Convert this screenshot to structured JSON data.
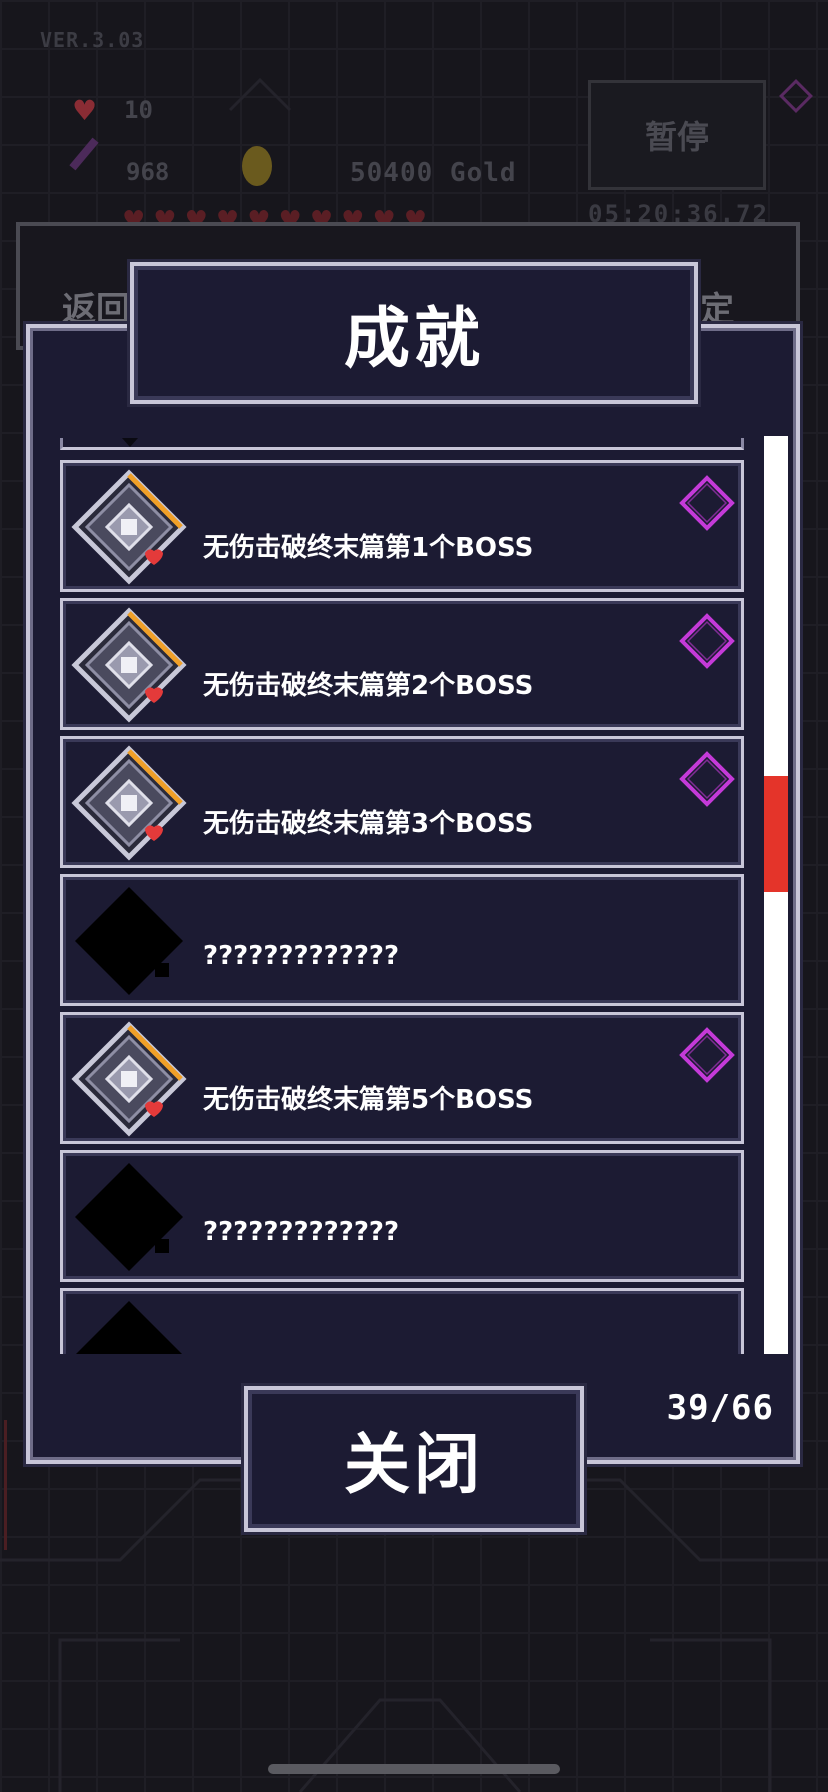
{
  "hud": {
    "version": "VER.3.03",
    "hp": "10",
    "attack": "968",
    "gold": "50400 Gold",
    "pause_label": "暂停",
    "time": "05:20:36.72",
    "back_label": "返回",
    "right_label": "定"
  },
  "modal": {
    "title": "成就",
    "counter": "39/66",
    "close_label": "关闭"
  },
  "achievements": [
    {
      "label": "无伤击破终末篇第1个BOSS",
      "unlocked": true
    },
    {
      "label": "无伤击破终末篇第2个BOSS",
      "unlocked": true
    },
    {
      "label": "无伤击破终末篇第3个BOSS",
      "unlocked": true
    },
    {
      "label": "?????????????",
      "unlocked": false
    },
    {
      "label": "无伤击破终末篇第5个BOSS",
      "unlocked": true
    },
    {
      "label": "?????????????",
      "unlocked": false
    },
    {
      "label": "",
      "unlocked": false
    }
  ],
  "scrollbar": {
    "position": 0.37
  },
  "colors": {
    "panel": "#1c1b33",
    "border": "#c8c6d8",
    "gem": "#c43ad8",
    "scroll_thumb": "#e4342a",
    "heart": "#e43a3a",
    "icon_accent": "#f0a028"
  }
}
